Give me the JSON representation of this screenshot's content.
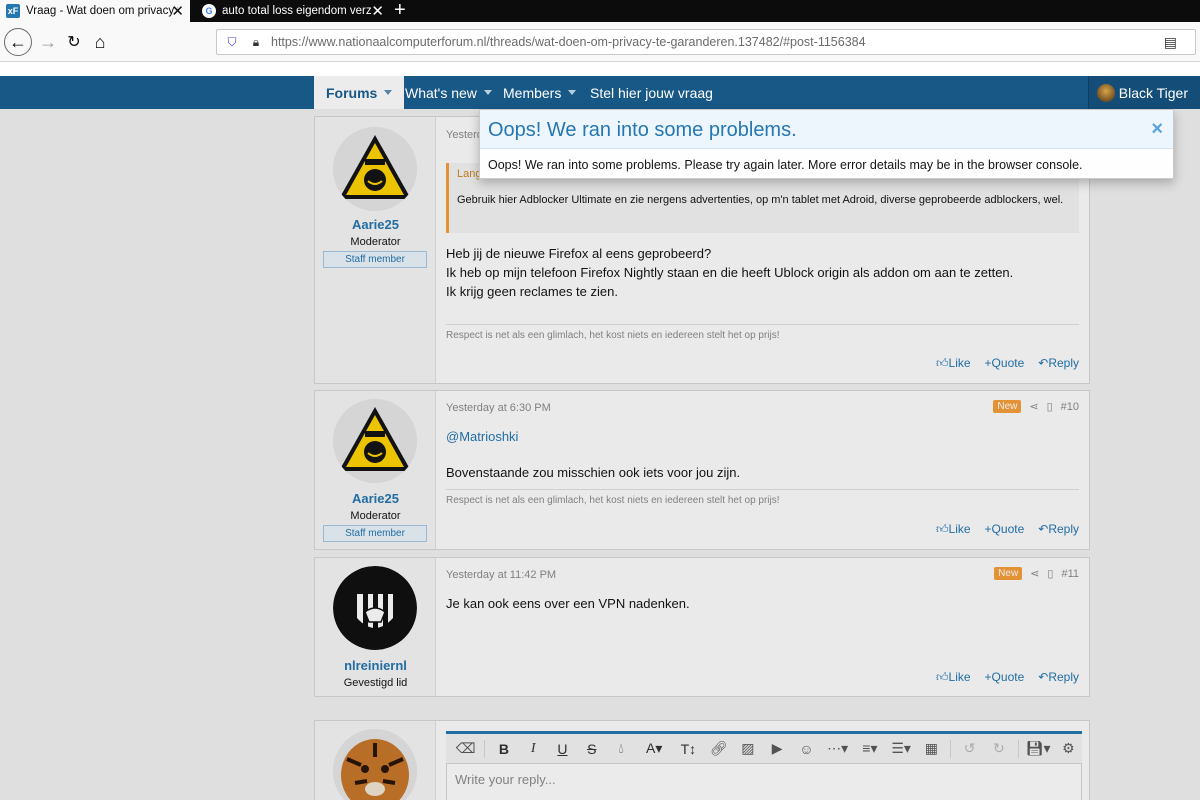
{
  "browser": {
    "tabs": [
      {
        "favicon": "xF",
        "title": "Vraag - Wat doen om privacy te"
      },
      {
        "favicon": "G",
        "title": "auto total loss eigendom verze"
      }
    ],
    "url": "https://www.nationaalcomputerforum.nl/threads/wat-doen-om-privacy-te-garanderen.137482/#post-1156384"
  },
  "forum_nav": {
    "items": [
      "Forums",
      "What's new",
      "Members",
      "Stel hier jouw vraag"
    ],
    "user": "Black Tiger"
  },
  "dialog": {
    "title": "Oops! We ran into some problems.",
    "message": "Oops! We ran into some problems. Please try again later. More error details may be in the browser console.",
    "close": "×"
  },
  "posts": [
    {
      "username": "Aarie25",
      "role": "Moderator",
      "badge": "Staff member",
      "date": "Yesterd",
      "quote_author": "Lang",
      "quote_text": "Gebruik hier Adblocker Ultimate en zie nergens advertenties, op m'n tablet met Adroid, diverse geprobeerde adblockers, wel.",
      "lines": [
        "Heb jij de nieuwe Firefox al eens geprobeerd?",
        "Ik heb op mijn telefoon Firefox Nightly staan en die heeft Ublock origin als addon om aan te zetten.",
        "Ik krijg geen reclames te zien."
      ],
      "signature": "Respect is net als een glimlach, het kost niets en iedereen stelt het op prijs!"
    },
    {
      "username": "Aarie25",
      "role": "Moderator",
      "badge": "Staff member",
      "date": "Yesterday at 6:30 PM",
      "new_badge": "New",
      "number": "#10",
      "mention": "@Matrioshki",
      "text": "Bovenstaande zou misschien ook iets voor jou zijn.",
      "signature": "Respect is net als een glimlach, het kost niets en iedereen stelt het op prijs!"
    },
    {
      "username": "nlreiniernl",
      "role": "Gevestigd lid",
      "date": "Yesterday at 11:42 PM",
      "new_badge": "New",
      "number": "#11",
      "text": "Je kan ook eens over een VPN nadenken."
    }
  ],
  "actions": {
    "like": "Like",
    "quote": "+Quote",
    "reply": "Reply"
  },
  "editor": {
    "placeholder": "Write your reply..."
  }
}
